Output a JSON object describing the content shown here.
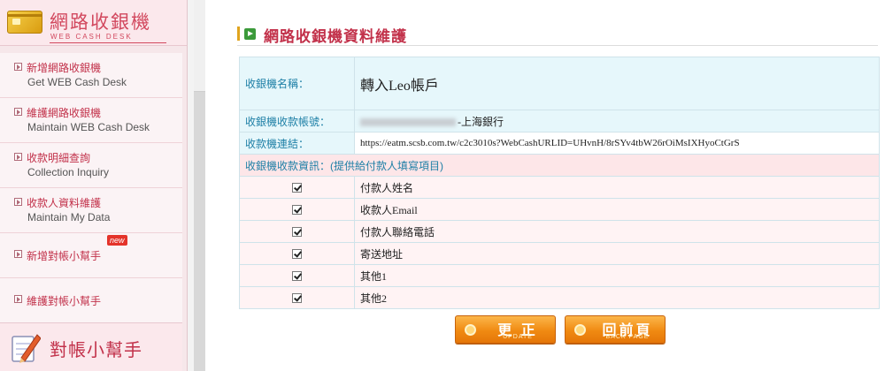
{
  "sidebar": {
    "title": "網路收銀機",
    "subtitle": "WEB CASH DESK",
    "items": [
      {
        "zh": "新增網路收銀機",
        "en": "Get WEB Cash Desk"
      },
      {
        "zh": "維護網路收銀機",
        "en": "Maintain WEB Cash Desk"
      },
      {
        "zh": "收款明細查詢",
        "en": "Collection Inquiry"
      },
      {
        "zh": "收款人資料維護",
        "en": "Maintain My Data"
      },
      {
        "zh": "新增對帳小幫手",
        "en": "",
        "badge": "new"
      },
      {
        "zh": "維護對帳小幫手",
        "en": ""
      }
    ],
    "footer_title": "對帳小幫手"
  },
  "main": {
    "title": "網路收銀機資料維護",
    "fields": {
      "name_label": "收銀機名稱：",
      "name_value": "轉入Leo帳戶",
      "account_label": "收銀機收款帳號：",
      "account_bank": "-上海銀行",
      "link_label": "收款機連結：",
      "link_value": "https://eatm.scsb.com.tw/c2c3010s?WebCashURLID=UHvnH/8rSYv4tbW26rOiMsIXHyoCtGrS",
      "section_label": "收銀機收款資訊：(提供給付款人填寫項目)"
    },
    "options": [
      {
        "label": "付款人姓名",
        "checked": true
      },
      {
        "label": "收款人Email",
        "checked": true
      },
      {
        "label": "付款人聯絡電話",
        "checked": true
      },
      {
        "label": "寄送地址",
        "checked": true
      },
      {
        "label": "其他1",
        "checked": true
      },
      {
        "label": "其他2",
        "checked": true
      }
    ],
    "buttons": {
      "update_zh": "更 正",
      "update_en": "UPDATE",
      "back_zh": "回前頁",
      "back_en": "BACK PAGE"
    }
  }
}
